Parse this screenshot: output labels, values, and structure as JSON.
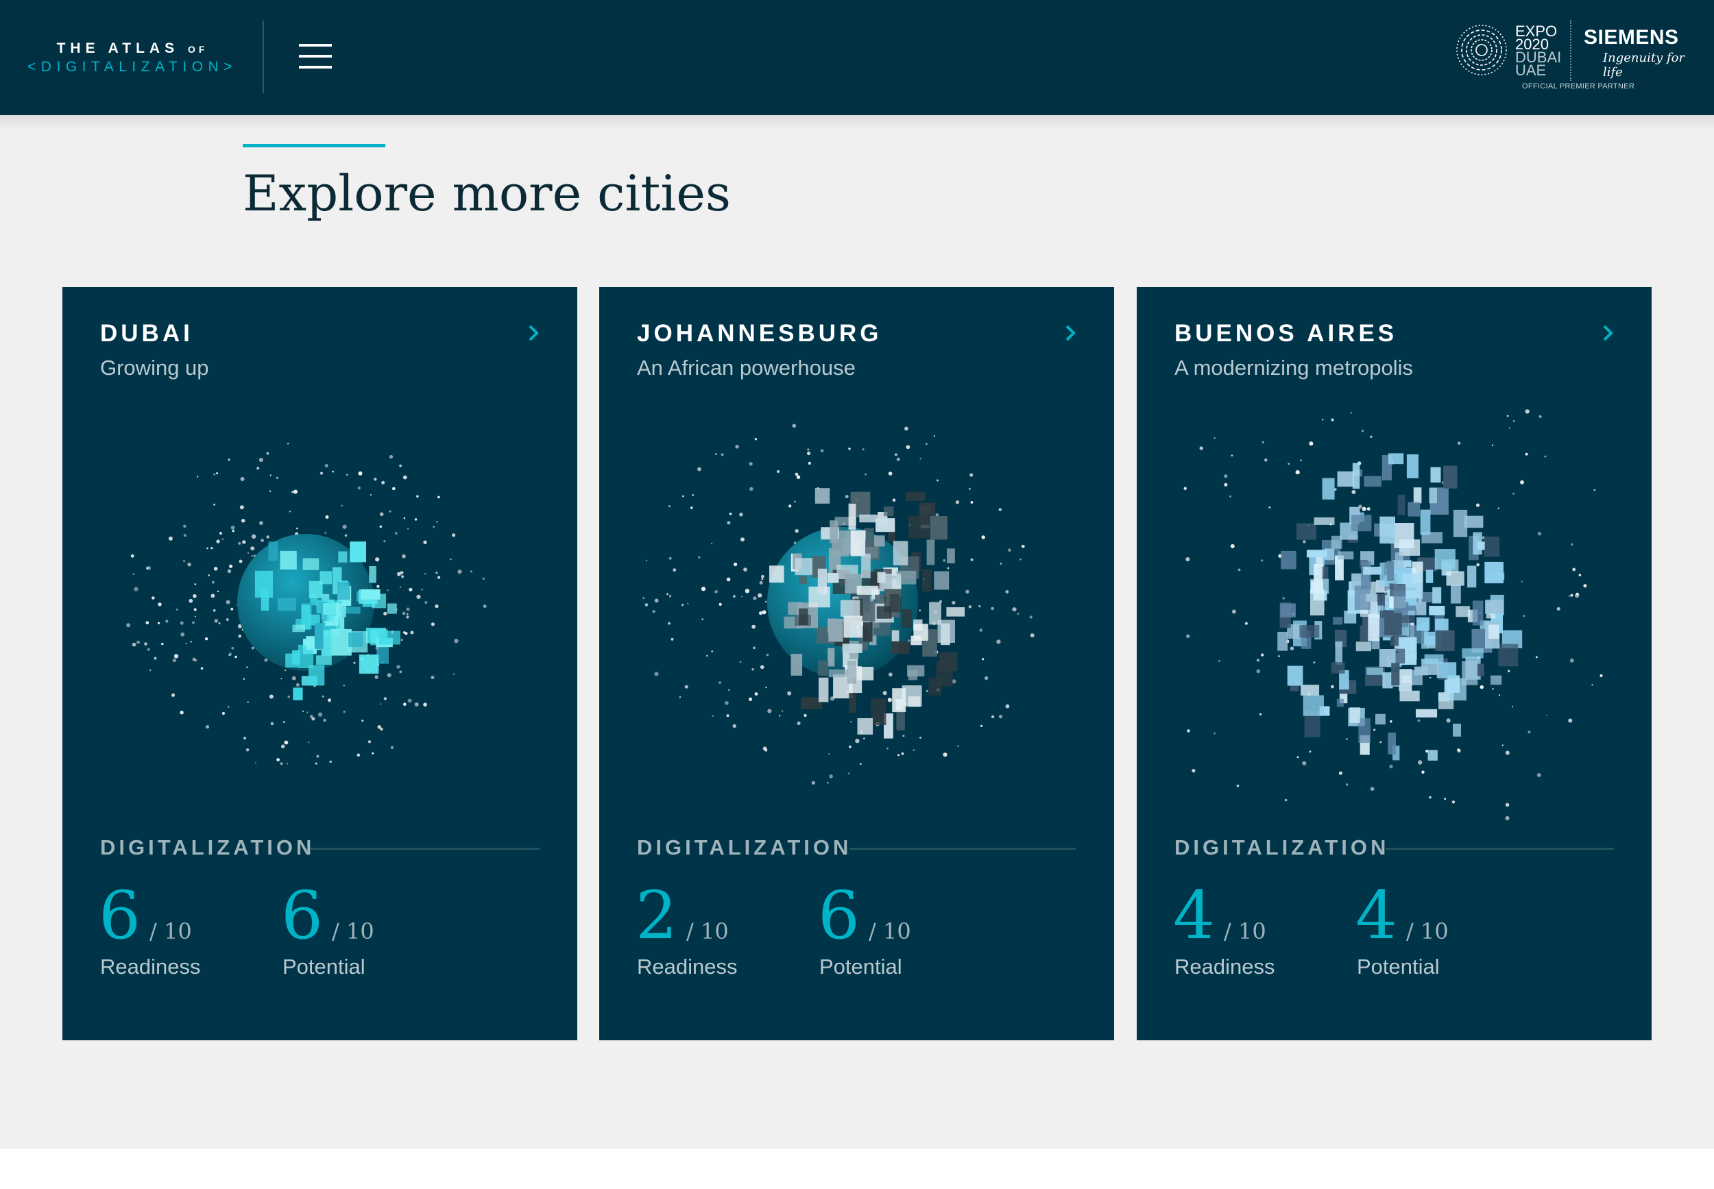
{
  "header": {
    "logo": {
      "line1": "THE ATLAS",
      "line1_suffix": "OF",
      "line2": "<DIGITALIZATION>"
    },
    "menu_icon": "hamburger-menu-icon",
    "partner": {
      "expo_lines": [
        "EXPO",
        "2020",
        "DUBAI",
        "UAE"
      ],
      "brand": "SIEMENS",
      "tagline": "Ingenuity for life",
      "caption": "OFFICIAL PREMIER PARTNER"
    }
  },
  "section": {
    "title": "Explore more cities"
  },
  "cards": [
    {
      "city": "DUBAI",
      "subtitle": "Growing up",
      "metric_label": "DIGITALIZATION",
      "readiness": {
        "value": "6",
        "max": "/ 10",
        "label": "Readiness"
      },
      "potential": {
        "value": "6",
        "max": "/ 10",
        "label": "Potential"
      }
    },
    {
      "city": "JOHANNESBURG",
      "subtitle": "An African powerhouse",
      "metric_label": "DIGITALIZATION",
      "readiness": {
        "value": "2",
        "max": "/ 10",
        "label": "Readiness"
      },
      "potential": {
        "value": "6",
        "max": "/ 10",
        "label": "Potential"
      }
    },
    {
      "city": "BUENOS AIRES",
      "subtitle": "A modernizing metropolis",
      "metric_label": "DIGITALIZATION",
      "readiness": {
        "value": "4",
        "max": "/ 10",
        "label": "Readiness"
      },
      "potential": {
        "value": "4",
        "max": "/ 10",
        "label": "Potential"
      }
    }
  ],
  "icons": {
    "card_arrow": "chevron-right-icon",
    "visual": "digitalization-globe-icon"
  },
  "colors": {
    "header_bg": "#003041",
    "card_bg": "#003448",
    "accent": "#00b3c6",
    "page_bg": "#f0f0f0",
    "title_text": "#0b2a36"
  }
}
